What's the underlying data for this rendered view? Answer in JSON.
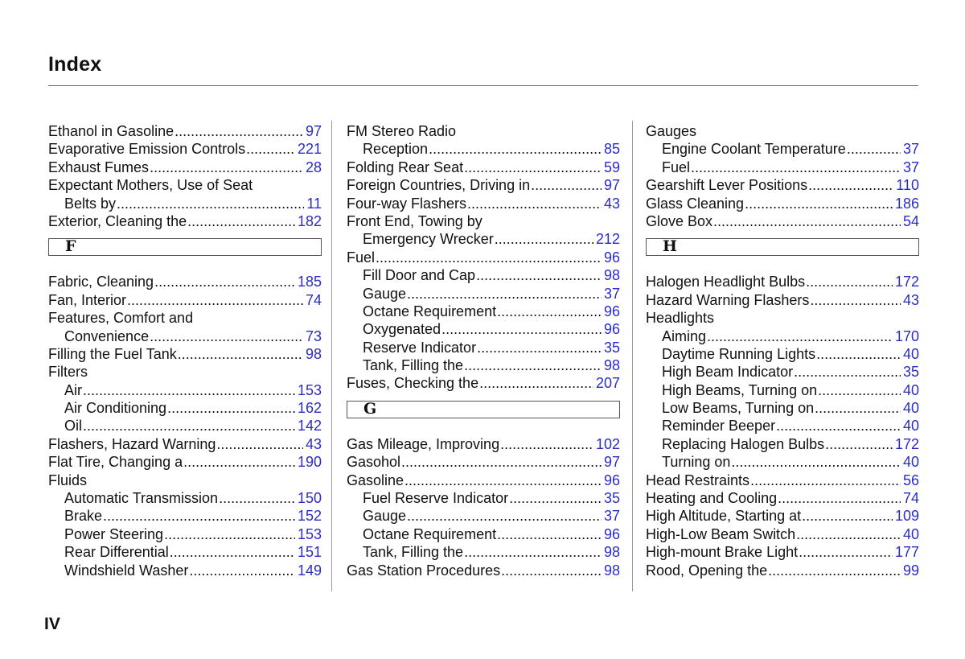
{
  "header": {
    "title": "Index"
  },
  "footer": {
    "page_number": "IV"
  },
  "colors": {
    "page_link": "#2b2bc9",
    "text": "#111111",
    "rule": "#6a6a6a"
  },
  "columns": [
    {
      "blocks": [
        {
          "type": "entries",
          "items": [
            {
              "label": "Ethanol in Gasoline",
              "page": "97",
              "level": 0
            },
            {
              "label": "Evaporative Emission Controls",
              "page": "221",
              "level": 0
            },
            {
              "label": "Exhaust Fumes",
              "page": "28",
              "level": 0
            },
            {
              "label": "Expectant Mothers, Use of Seat",
              "page": "",
              "level": 0
            },
            {
              "label": "Belts by",
              "page": "11",
              "level": 1
            },
            {
              "label": "Exterior, Cleaning the",
              "page": "182",
              "level": 0
            }
          ]
        },
        {
          "type": "letter",
          "letter": "F"
        },
        {
          "type": "entries",
          "items": [
            {
              "label": "Fabric, Cleaning",
              "page": "185",
              "level": 0
            },
            {
              "label": "Fan, Interior",
              "page": "74",
              "level": 0
            },
            {
              "label": "Features, Comfort and",
              "page": "",
              "level": 0
            },
            {
              "label": "Convenience",
              "page": "73",
              "level": 1
            },
            {
              "label": "Filling the Fuel Tank",
              "page": "98",
              "level": 0
            },
            {
              "label": "Filters",
              "page": "",
              "level": 0
            },
            {
              "label": "Air",
              "page": "153",
              "level": 1
            },
            {
              "label": "Air Conditioning",
              "page": "162",
              "level": 1
            },
            {
              "label": "Oil",
              "page": "142",
              "level": 1
            },
            {
              "label": "Flashers, Hazard Warning",
              "page": "43",
              "level": 0
            },
            {
              "label": "Flat Tire, Changing a",
              "page": "190",
              "level": 0
            },
            {
              "label": "Fluids",
              "page": "",
              "level": 0
            },
            {
              "label": "Automatic Transmission",
              "page": "150",
              "level": 1
            },
            {
              "label": "Brake",
              "page": "152",
              "level": 1
            },
            {
              "label": "Power Steering",
              "page": "153",
              "level": 1
            },
            {
              "label": "Rear Differential",
              "page": "151",
              "level": 1
            },
            {
              "label": "Windshield Washer",
              "page": "149",
              "level": 1
            }
          ]
        }
      ]
    },
    {
      "blocks": [
        {
          "type": "entries",
          "items": [
            {
              "label": "FM Stereo Radio",
              "page": "",
              "level": 0
            },
            {
              "label": "Reception",
              "page": "85",
              "level": 1
            },
            {
              "label": "Folding Rear Seat",
              "page": "59",
              "level": 0
            },
            {
              "label": "Foreign Countries, Driving in",
              "page": "97",
              "level": 0
            },
            {
              "label": "Four-way Flashers",
              "page": "43",
              "level": 0
            },
            {
              "label": "Front End, Towing by",
              "page": "",
              "level": 0
            },
            {
              "label": "Emergency Wrecker",
              "page": "212",
              "level": 1
            },
            {
              "label": "Fuel",
              "page": "96",
              "level": 0
            },
            {
              "label": "Fill Door and Cap",
              "page": "98",
              "level": 1
            },
            {
              "label": "Gauge",
              "page": "37",
              "level": 1
            },
            {
              "label": "Octane Requirement",
              "page": "96",
              "level": 1
            },
            {
              "label": "Oxygenated",
              "page": "96",
              "level": 1
            },
            {
              "label": "Reserve Indicator",
              "page": "35",
              "level": 1
            },
            {
              "label": "Tank, Filling the",
              "page": "98",
              "level": 1
            },
            {
              "label": "Fuses, Checking the",
              "page": "207",
              "level": 0
            }
          ]
        },
        {
          "type": "letter",
          "letter": "G"
        },
        {
          "type": "entries",
          "items": [
            {
              "label": "Gas Mileage, Improving",
              "page": "102",
              "level": 0
            },
            {
              "label": "Gasohol",
              "page": "97",
              "level": 0
            },
            {
              "label": "Gasoline",
              "page": "96",
              "level": 0
            },
            {
              "label": "Fuel Reserve Indicator",
              "page": "35",
              "level": 1
            },
            {
              "label": "Gauge",
              "page": "37",
              "level": 1
            },
            {
              "label": "Octane Requirement",
              "page": "96",
              "level": 1
            },
            {
              "label": "Tank, Filling the",
              "page": "98",
              "level": 1
            },
            {
              "label": "Gas Station Procedures",
              "page": "98",
              "level": 0
            }
          ]
        }
      ]
    },
    {
      "blocks": [
        {
          "type": "entries",
          "items": [
            {
              "label": "Gauges",
              "page": "",
              "level": 0
            },
            {
              "label": "Engine Coolant Temperature",
              "page": "37",
              "level": 1
            },
            {
              "label": "Fuel",
              "page": "37",
              "level": 1
            },
            {
              "label": "Gearshift Lever Positions",
              "page": "110",
              "level": 0
            },
            {
              "label": "Glass Cleaning",
              "page": "186",
              "level": 0
            },
            {
              "label": "Glove Box",
              "page": "54",
              "level": 0
            }
          ]
        },
        {
          "type": "letter",
          "letter": "H"
        },
        {
          "type": "entries",
          "items": [
            {
              "label": "Halogen Headlight Bulbs",
              "page": "172",
              "level": 0
            },
            {
              "label": "Hazard Warning Flashers",
              "page": "43",
              "level": 0
            },
            {
              "label": "Headlights",
              "page": "",
              "level": 0
            },
            {
              "label": "Aiming",
              "page": "170",
              "level": 1
            },
            {
              "label": "Daytime Running Lights",
              "page": "40",
              "level": 1
            },
            {
              "label": "High Beam Indicator",
              "page": "35",
              "level": 1
            },
            {
              "label": "High Beams, Turning on",
              "page": "40",
              "level": 1
            },
            {
              "label": "Low Beams, Turning on",
              "page": "40",
              "level": 1
            },
            {
              "label": "Reminder Beeper",
              "page": "40",
              "level": 1
            },
            {
              "label": "Replacing Halogen Bulbs",
              "page": "172",
              "level": 1
            },
            {
              "label": "Turning on",
              "page": "40",
              "level": 1
            },
            {
              "label": "Head Restraints",
              "page": "56",
              "level": 0
            },
            {
              "label": "Heating and Cooling",
              "page": "74",
              "level": 0
            },
            {
              "label": "High Altitude, Starting at",
              "page": "109",
              "level": 0
            },
            {
              "label": "High-Low Beam Switch",
              "page": "40",
              "level": 0
            },
            {
              "label": "High-mount Brake Light",
              "page": "177",
              "level": 0
            },
            {
              "label": "Rood, Opening the",
              "page": "99",
              "level": 0
            }
          ]
        }
      ]
    }
  ]
}
